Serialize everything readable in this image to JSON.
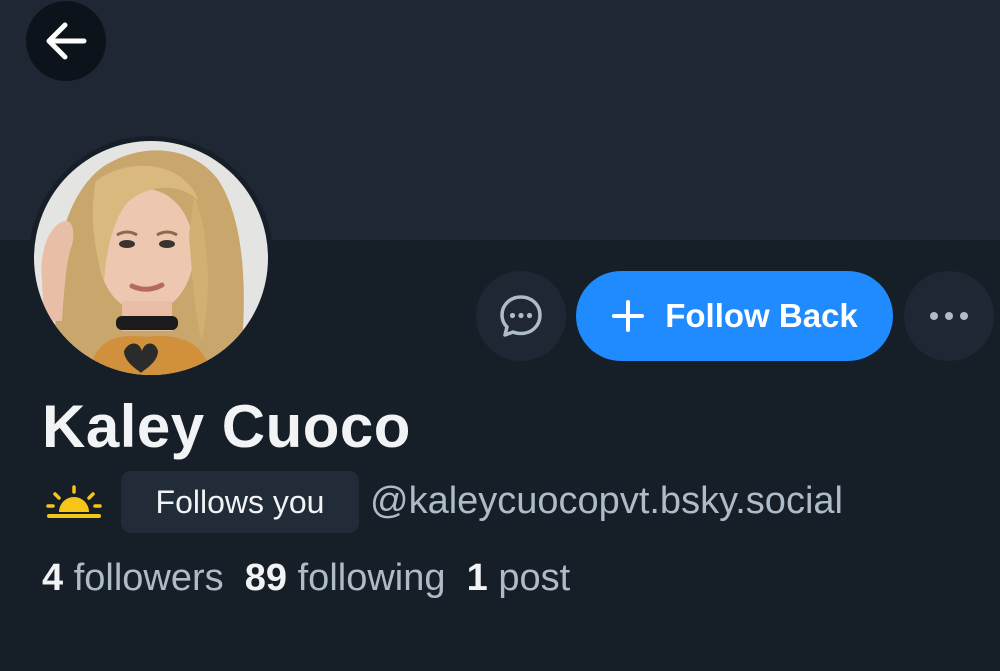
{
  "profile": {
    "display_name": "Kaley Cuoco",
    "handle": "@kaleycuocopvt.bsky.social",
    "follows_you_label": "Follows you",
    "follow_back_label": "Follow Back"
  },
  "stats": {
    "followers_count": "4",
    "followers_label": "followers",
    "following_count": "89",
    "following_label": "following",
    "posts_count": "1",
    "posts_label": "post"
  },
  "icons": {
    "back": "arrow-left-icon",
    "message": "chat-bubble-icon",
    "follow": "plus-icon",
    "more": "ellipsis-icon",
    "status": "sunrise-icon",
    "avatar": "profile-photo"
  },
  "colors": {
    "background": "#161e27",
    "banner": "#1e2733",
    "accent": "#208bfe",
    "sun": "#f5c518",
    "text_primary": "#f1f3f5",
    "text_secondary": "#aebbc9"
  }
}
